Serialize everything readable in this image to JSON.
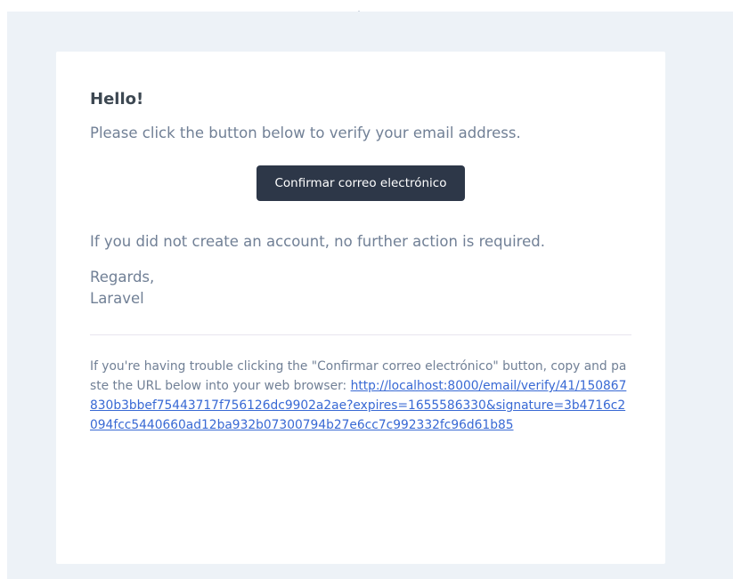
{
  "email": {
    "greeting": "Hello!",
    "intro_line": "Please click the button below to verify your email address.",
    "action_label": "Confirmar correo electrónico",
    "outro_line": "If you did not create an account, no further action is required.",
    "salutation": "Regards,",
    "sender_name": "Laravel",
    "subcopy_text": "If you're having trouble clicking the \"Confirmar correo electrónico\" button, copy and paste the URL below into your web browser: ",
    "verify_url": "http://localhost:8000/email/verify/41/150867830b3bbef75443717f756126dc9902a2ae?expires=1655586330&signature=3b4716c2094fcc5440660ad12ba932b07300794b27e6cc7c992332fc96d61b85"
  },
  "colors": {
    "background": "#edf2f7",
    "card": "#ffffff",
    "button": "#2d3748",
    "link": "#3869d4",
    "text": "#718096",
    "heading": "#3d4852"
  }
}
